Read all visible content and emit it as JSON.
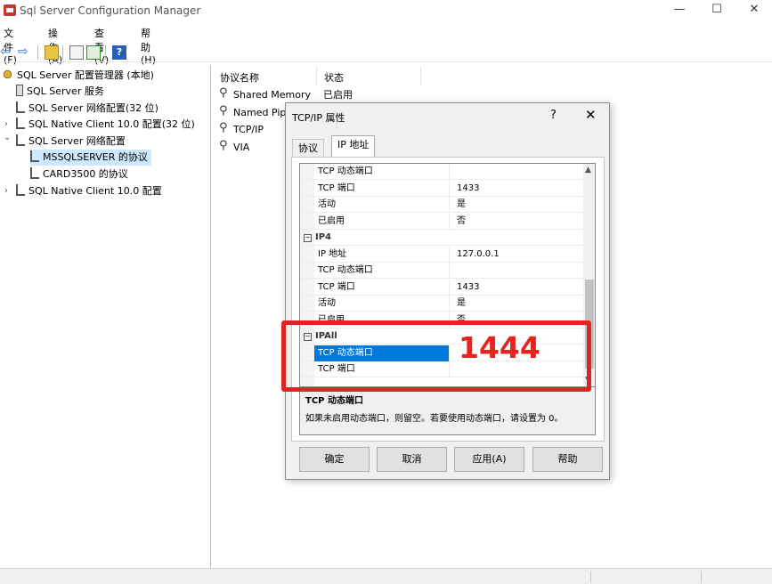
{
  "window": {
    "title": "Sql Server Configuration Manager",
    "minimize": "—",
    "maximize": "☐",
    "close": "✕"
  },
  "menu": [
    "文件(F)",
    "操作(A)",
    "查看(V)",
    "帮助(H)"
  ],
  "toolbar": {
    "back_icon": "⇦",
    "forward_icon": "⇨",
    "help_label": "?"
  },
  "tree": {
    "root": "SQL Server 配置管理器 (本地)",
    "services": "SQL Server 服务",
    "network32": "SQL Server 网络配置(32 位)",
    "native32": "SQL Native Client 10.0 配置(32 位)",
    "network": "SQL Server 网络配置",
    "mssqlserver": "MSSQLSERVER 的协议",
    "card3500": "CARD3500 的协议",
    "native": "SQL Native Client 10.0 配置",
    "chev_closed": "›",
    "chev_open": "⌄"
  },
  "list": {
    "col_name": "协议名称",
    "col_status": "状态",
    "rows": [
      {
        "name": "Shared Memory",
        "status": "已启用"
      },
      {
        "name": "Named Pipes",
        "status": ""
      },
      {
        "name": "TCP/IP",
        "status": ""
      },
      {
        "name": "VIA",
        "status": ""
      }
    ]
  },
  "dialog": {
    "title": "TCP/IP 属性",
    "help": "?",
    "close": "✕",
    "tabs": [
      "协议",
      "IP 地址"
    ],
    "rows": [
      {
        "type": "prop",
        "key": "TCP 动态端口",
        "value": ""
      },
      {
        "type": "prop",
        "key": "TCP 端口",
        "value": "1433"
      },
      {
        "type": "prop",
        "key": "活动",
        "value": "是"
      },
      {
        "type": "prop",
        "key": "已启用",
        "value": "否"
      },
      {
        "type": "section",
        "key": "IP4",
        "box": "−"
      },
      {
        "type": "prop",
        "key": "IP 地址",
        "value": "127.0.0.1"
      },
      {
        "type": "prop",
        "key": "TCP 动态端口",
        "value": ""
      },
      {
        "type": "prop",
        "key": "TCP 端口",
        "value": "1433"
      },
      {
        "type": "prop",
        "key": "活动",
        "value": "是"
      },
      {
        "type": "prop",
        "key": "已启用",
        "value": "否"
      },
      {
        "type": "section",
        "key": "IPAll",
        "box": "−"
      },
      {
        "type": "prop",
        "key": "TCP 动态端口",
        "value": "",
        "selected": true
      },
      {
        "type": "prop",
        "key": "TCP 端口",
        "value": ""
      }
    ],
    "scroll_up": "▲",
    "scroll_down": "▼",
    "desc_title": "TCP 动态端口",
    "desc_text": "如果未启用动态端口，则留空。若要使用动态端口，请设置为 0。",
    "buttons": {
      "ok": "确定",
      "cancel": "取消",
      "apply": "应用(A)",
      "help": "帮助"
    }
  },
  "annotation": {
    "text": "1444",
    "color": "#e02424"
  }
}
